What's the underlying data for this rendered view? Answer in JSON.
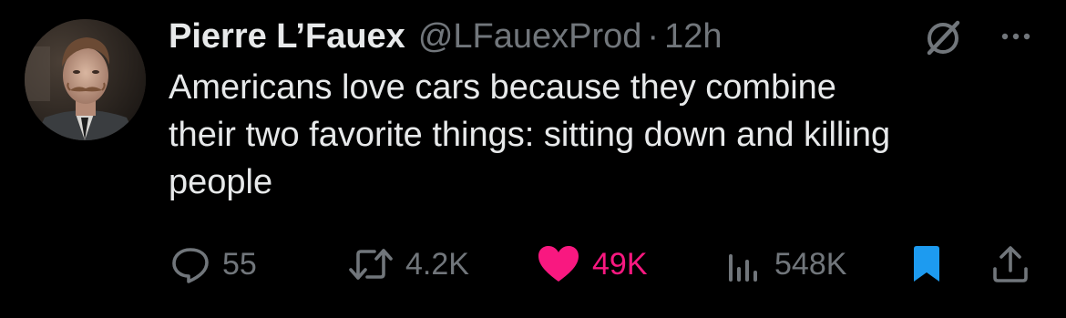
{
  "tweet": {
    "author": {
      "display_name": "Pierre L’Fauex",
      "handle": "@LFauexProd",
      "separator": "·",
      "time": "12h"
    },
    "text_lines": [
      "Americans love cars because they combine",
      "their two favorite things: sitting down and killing",
      "people"
    ],
    "header_icons": {
      "grok": "grok-icon",
      "more": "more-icon"
    },
    "actions": {
      "reply": {
        "icon": "reply-icon",
        "count": "55"
      },
      "retweet": {
        "icon": "retweet-icon",
        "count": "4.2K"
      },
      "like": {
        "icon": "heart-icon",
        "count": "49K",
        "active": true,
        "color": "#f91880"
      },
      "views": {
        "icon": "views-icon",
        "count": "548K"
      },
      "bookmark": {
        "icon": "bookmark-icon",
        "active": true,
        "color": "#1d9bf0"
      },
      "share": {
        "icon": "share-icon"
      }
    }
  },
  "colors": {
    "background": "#000000",
    "primary_text": "#e7e9ea",
    "secondary_text": "#71767b",
    "like": "#f91880",
    "bookmark": "#1d9bf0"
  }
}
